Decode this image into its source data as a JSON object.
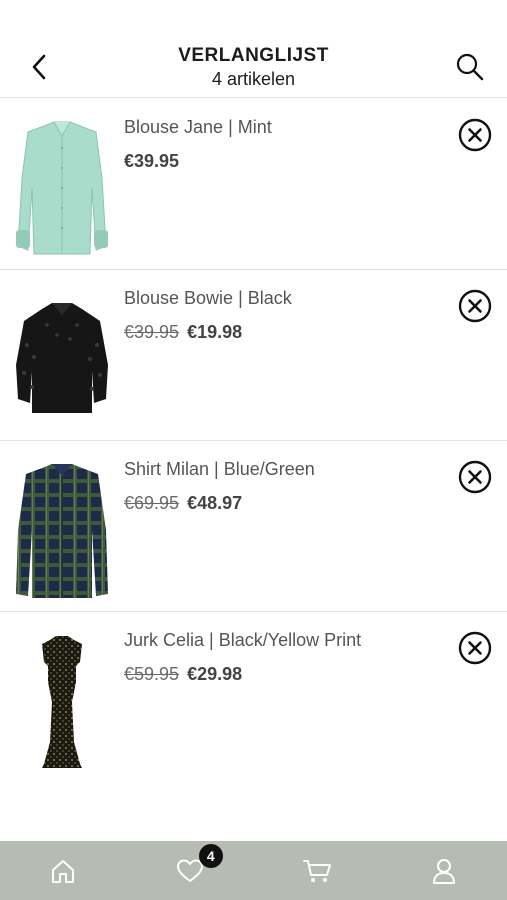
{
  "header": {
    "title": "VERLANGLIJST",
    "subtitle": "4 artikelen",
    "back_icon": "chevron-left-icon",
    "search_icon": "search-icon"
  },
  "items": [
    {
      "name": "Blouse Jane | Mint",
      "old_price": "",
      "price": "€39.95",
      "image": "mint-blouse"
    },
    {
      "name": "Blouse Bowie | Black",
      "old_price": "€39.95",
      "price": "€19.98",
      "image": "black-lace-blouse"
    },
    {
      "name": "Shirt Milan | Blue/Green",
      "old_price": "€69.95",
      "price": "€48.97",
      "image": "plaid-shirt"
    },
    {
      "name": "Jurk Celia | Black/Yellow Print",
      "old_price": "€59.95",
      "price": "€29.98",
      "image": "print-dress"
    }
  ],
  "nav": {
    "items": [
      "home-icon",
      "heart-icon",
      "cart-icon",
      "user-icon"
    ],
    "wishlist_badge": "4",
    "background": "#b6bcb1"
  }
}
